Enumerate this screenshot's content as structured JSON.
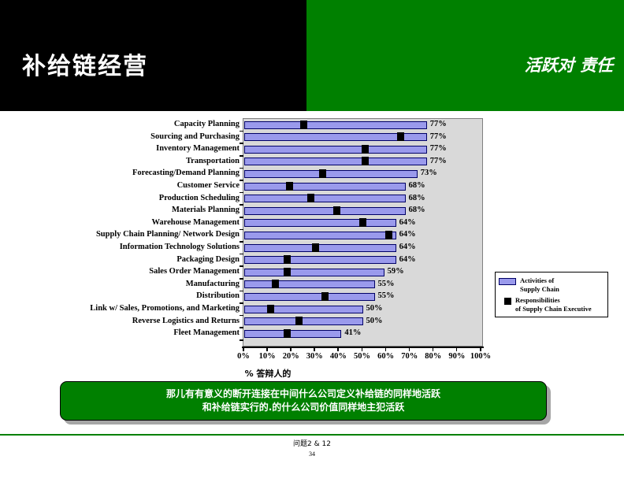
{
  "header": {
    "title": "补给链经营",
    "subtitle": "活跃对 责任",
    "black_color": "#000000",
    "green_color": "#008000"
  },
  "chart_data": {
    "type": "bar",
    "title": "",
    "xlabel": "% 答辩人的",
    "ylabel": "",
    "xlim": [
      0,
      100
    ],
    "xticks": [
      "0%",
      "10%",
      "20%",
      "30%",
      "40%",
      "50%",
      "60%",
      "70%",
      "80%",
      "90%",
      "100%"
    ],
    "grid": false,
    "legend_position": "right",
    "bar_color": "#9a9aec",
    "marker_color": "#000000",
    "plot_background": "#d9d9d9",
    "categories": [
      "Capacity Planning",
      "Sourcing and Purchasing",
      "Inventory Management",
      "Transportation",
      "Forecasting/Demand Planning",
      "Customer Service",
      "Production Scheduling",
      "Materials Planning",
      "Warehouse Management",
      "Supply Chain Planning/ Network Design",
      "Information Technology Solutions",
      "Packaging Design",
      "Sales Order Management",
      "Manufacturing",
      "Distribution",
      "Link w/ Sales, Promotions, and Marketing",
      "Reverse Logistics and Returns",
      "Fleet Management"
    ],
    "series": [
      {
        "name": "Activities of Supply Chain",
        "type": "bar",
        "values": [
          77,
          77,
          77,
          77,
          73,
          68,
          68,
          68,
          64,
          64,
          64,
          64,
          59,
          55,
          55,
          50,
          50,
          41
        ]
      },
      {
        "name": "Responsibilities of Supply Chain Executive",
        "type": "marker",
        "values": [
          25,
          66,
          51,
          51,
          33,
          19,
          28,
          39,
          50,
          61,
          30,
          18,
          18,
          13,
          34,
          11,
          23,
          18
        ]
      }
    ],
    "value_labels": [
      "77%",
      "77%",
      "77%",
      "77%",
      "73%",
      "68%",
      "68%",
      "68%",
      "64%",
      "64%",
      "64%",
      "64%",
      "59%",
      "55%",
      "55%",
      "50%",
      "50%",
      "41%"
    ],
    "legend": [
      "Activities of Supply Chain",
      "Responsibilities of Supply Chain Executive"
    ],
    "legend_lines": [
      [
        "Activities of",
        "Supply Chain"
      ],
      [
        "Responsibilities",
        "of Supply Chain Executive"
      ]
    ]
  },
  "callout": {
    "line1": "那儿有有意义的断开连接在中间什么公司定义补给链的同样地活跃",
    "line2": "和补给链实行的.的什么公司价值同样地主犯活跃",
    "background": "#008000"
  },
  "footer": {
    "question": "问题2 & 12",
    "page": "34",
    "rule_color": "#008000"
  }
}
